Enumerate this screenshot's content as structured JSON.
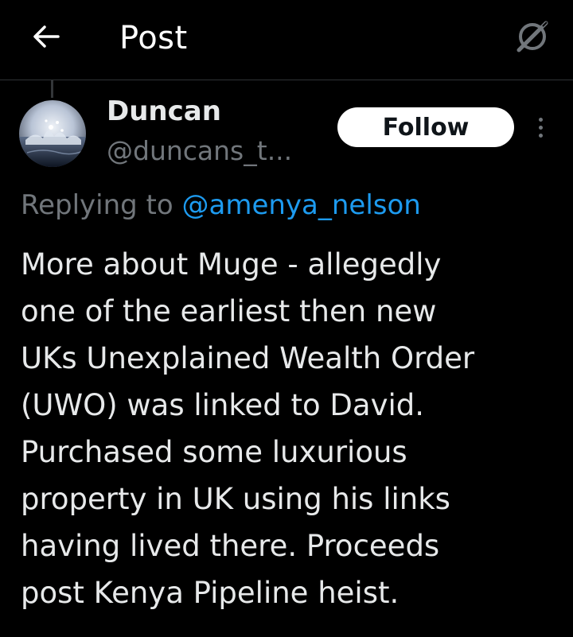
{
  "header": {
    "title": "Post",
    "back_icon": "arrow-left-icon",
    "grok_icon": "grok-icon"
  },
  "author": {
    "name": "Duncan",
    "handle": "@duncans_t...",
    "avatar": "water-splash-avatar"
  },
  "actions": {
    "follow_label": "Follow",
    "more_icon": "more-vertical-icon"
  },
  "reply": {
    "prefix": "Replying to",
    "mention": "@amenya_nelson"
  },
  "tweet": {
    "lines": [
      "More about Muge - allegedly",
      "one of the earliest then new",
      "UKs Unexplained Wealth Order",
      "(UWO) was linked to David.",
      "Purchased some luxurious",
      "property in UK using his links",
      "having lived there. Proceeds",
      "post Kenya Pipeline heist."
    ]
  },
  "colors": {
    "background": "#000000",
    "text": "#e7e9ea",
    "muted": "#71767b",
    "accent": "#1d9bf0",
    "follow_bg": "#ffffff"
  }
}
